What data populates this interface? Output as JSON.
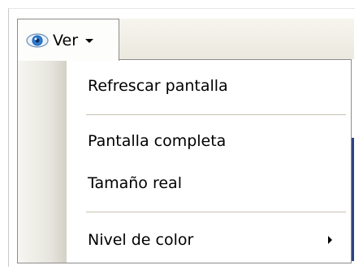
{
  "toolbar": {
    "view_button": {
      "label": "Ver",
      "icon": "eye-icon",
      "dropdown_icon": "chevron-down-icon"
    }
  },
  "menu": {
    "items": [
      {
        "label": "Refrescar pantalla"
      },
      {
        "label": "Pantalla completa"
      },
      {
        "label": "Tamaño real"
      },
      {
        "label": "Nivel de color",
        "submenu_icon": "chevron-right-icon"
      }
    ]
  },
  "colors": {
    "menu_border": "#8c8c8c",
    "background_blue": "#2d4580",
    "eye_iris": "#2f7fd8"
  }
}
